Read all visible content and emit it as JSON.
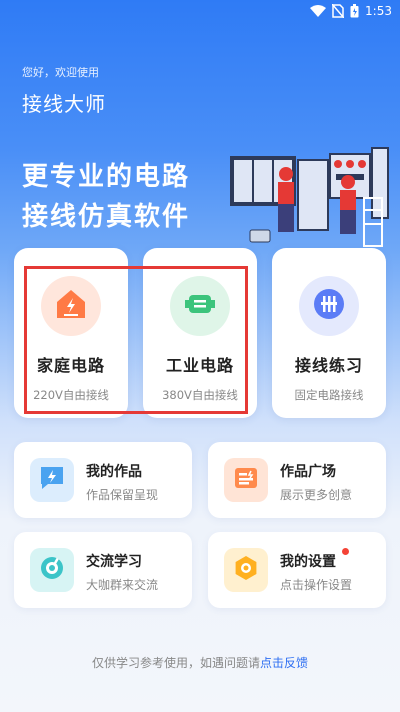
{
  "status": {
    "time": "1:53"
  },
  "header": {
    "greeting": "您好，欢迎使用",
    "app_title": "接线大师"
  },
  "hero": {
    "line1": "更专业的电路",
    "line2": "接线仿真软件"
  },
  "big_cards": [
    {
      "title": "家庭电路",
      "subtitle": "220V自由接线",
      "icon": "lightning-plug-icon",
      "color": "#ff7a45"
    },
    {
      "title": "工业电路",
      "subtitle": "380V自由接线",
      "icon": "motor-icon",
      "color": "#3cc47c"
    },
    {
      "title": "接线练习",
      "subtitle": "固定电路接线",
      "icon": "terminal-block-icon",
      "color": "#5b7cf6"
    }
  ],
  "small_cards": [
    {
      "title": "我的作品",
      "subtitle": "作品保留呈现",
      "icon": "chat-lightning-icon",
      "color": "#4aa3f0"
    },
    {
      "title": "作品广场",
      "subtitle": "展示更多创意",
      "icon": "gallery-icon",
      "color": "#ff8a4c"
    },
    {
      "title": "交流学习",
      "subtitle": "大咖群来交流",
      "icon": "compass-icon",
      "color": "#3cc4c8"
    },
    {
      "title": "我的设置",
      "subtitle": "点击操作设置",
      "icon": "settings-nut-icon",
      "color": "#ffb020"
    }
  ],
  "footer": {
    "text": "仅供学习参考使用，如遇问题请",
    "link": "点击反馈"
  },
  "colors": {
    "primary": "#2f7bf5",
    "highlight": "#e53935",
    "link": "#2f6ff2"
  }
}
